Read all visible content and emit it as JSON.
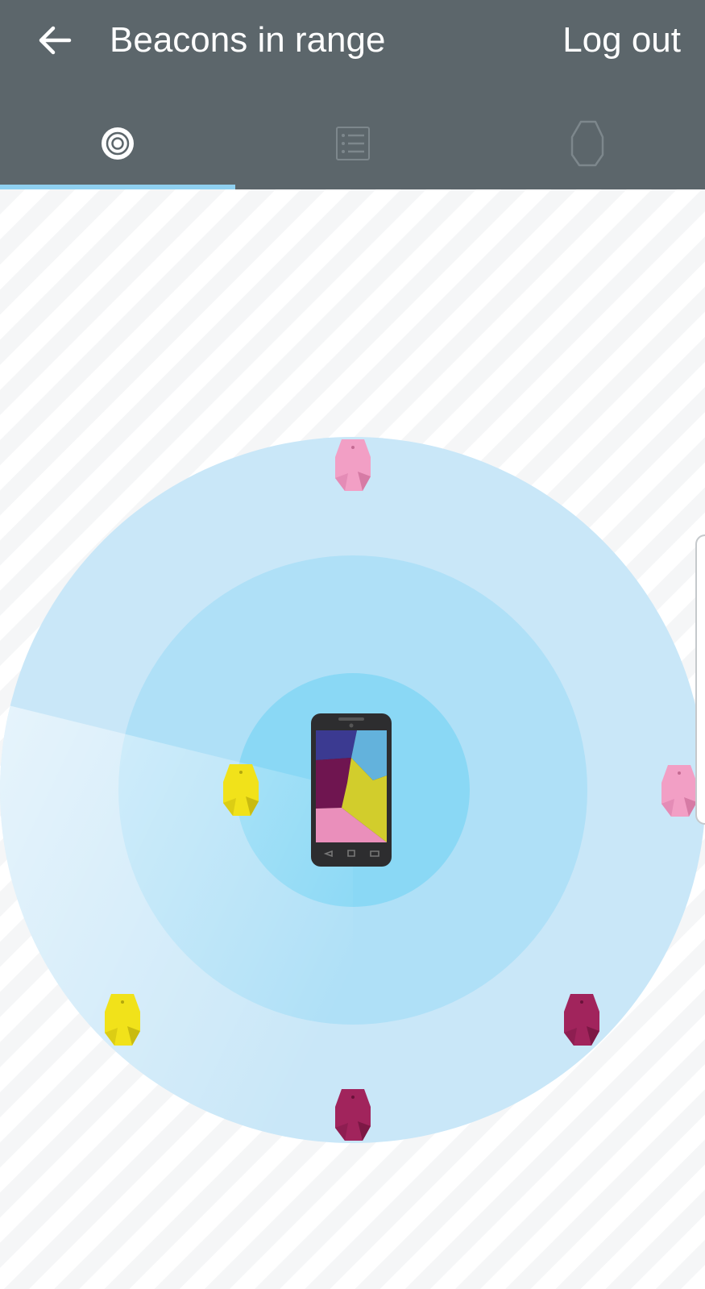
{
  "header": {
    "title": "Beacons in range",
    "logout_label": "Log out",
    "back_icon": "arrow-left-icon"
  },
  "tabs": [
    {
      "icon": "radar-icon",
      "active": true
    },
    {
      "icon": "list-icon",
      "active": false
    },
    {
      "icon": "beacon-outline-icon",
      "active": false
    }
  ],
  "radar": {
    "center_device": "smartphone",
    "beacons": [
      {
        "color_name": "pink",
        "color": "#f29fc5"
      },
      {
        "color_name": "pink",
        "color": "#f29fc5"
      },
      {
        "color_name": "yellow",
        "color": "#f1e21a"
      },
      {
        "color_name": "yellow",
        "color": "#f1e21a"
      },
      {
        "color_name": "berry",
        "color": "#a1245c"
      },
      {
        "color_name": "berry",
        "color": "#a1245c"
      }
    ]
  },
  "colors": {
    "appbar": "#5c666b",
    "accent": "#8fd0f0",
    "ring_outer": "#c9e7f8",
    "ring_middle": "#afe0f7",
    "ring_inner": "#8ad8f5"
  }
}
